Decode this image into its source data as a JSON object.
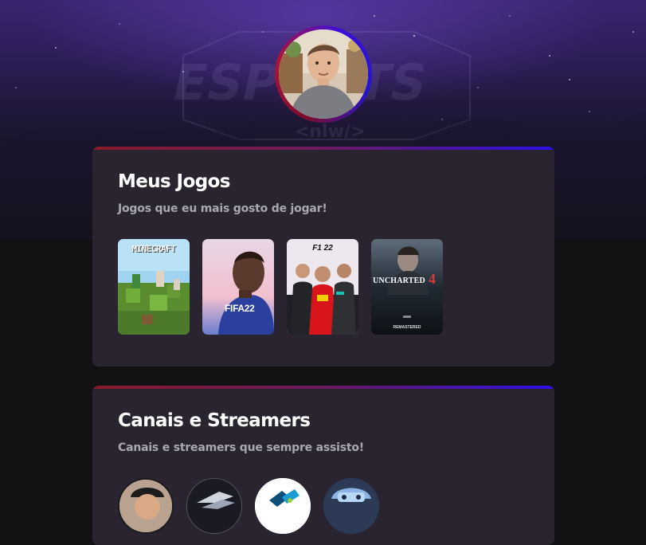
{
  "profile": {
    "avatar_alt": "Profile photo"
  },
  "sections": {
    "games": {
      "title": "Meus Jogos",
      "subtitle": "Jogos que eu mais gosto de jogar!",
      "items": [
        {
          "name": "Minecraft",
          "label": "MINECRAFT"
        },
        {
          "name": "FIFA 22",
          "label": "FIFA22"
        },
        {
          "name": "F1 22",
          "label": "F1 22"
        },
        {
          "name": "Uncharted 4",
          "label": "UNCHARTED",
          "number": "4",
          "badge": "REMASTERED"
        }
      ]
    },
    "channels": {
      "title": "Canais e Streamers",
      "subtitle": "Canais e streamers que sempre assisto!",
      "items": [
        {
          "name": "channel-1"
        },
        {
          "name": "channel-2"
        },
        {
          "name": "channel-3"
        },
        {
          "name": "channel-4"
        }
      ]
    }
  },
  "colors": {
    "background": "#121214",
    "card": "#29242f",
    "accent_red": "#8a1a2a",
    "accent_blue": "#2d10e6",
    "subtitle": "#a8a8b3"
  }
}
